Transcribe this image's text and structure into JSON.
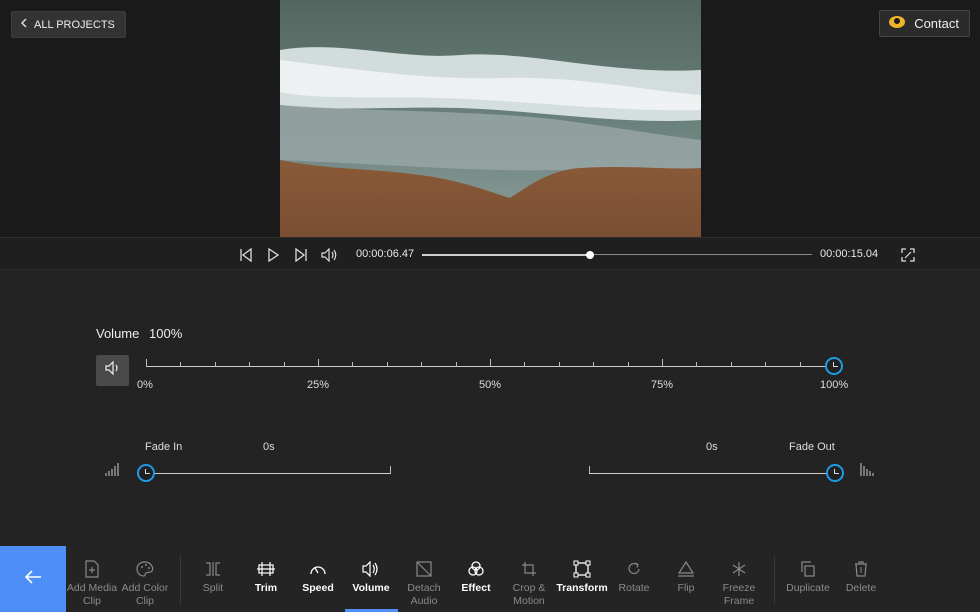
{
  "header": {
    "back_label": "ALL PROJECTS",
    "contact_label": "Contact"
  },
  "player": {
    "current_time": "00:00:06.47",
    "total_time": "00:00:15.04",
    "progress": 0.43
  },
  "volume_panel": {
    "title": "Volume",
    "value": "100%",
    "level": 1.0,
    "ticks": [
      "0%",
      "25%",
      "50%",
      "75%",
      "100%"
    ],
    "fade_in": {
      "label": "Fade In",
      "value": "0s"
    },
    "fade_out": {
      "label": "Fade Out",
      "value": "0s"
    }
  },
  "toolbar": {
    "items": [
      {
        "label": "Add Media\nClip",
        "icon": "add-media-icon",
        "active": false
      },
      {
        "label": "Add Color\nClip",
        "icon": "palette-icon",
        "active": false
      },
      {
        "label": "Split",
        "icon": "split-icon",
        "active": false
      },
      {
        "label": "Trim",
        "icon": "trim-icon",
        "active": true
      },
      {
        "label": "Speed",
        "icon": "speed-icon",
        "active": true
      },
      {
        "label": "Volume",
        "icon": "volume-icon",
        "active": true
      },
      {
        "label": "Detach\nAudio",
        "icon": "detach-audio-icon",
        "active": false
      },
      {
        "label": "Effect",
        "icon": "effect-icon",
        "active": true
      },
      {
        "label": "Crop &\nMotion",
        "icon": "crop-icon",
        "active": false
      },
      {
        "label": "Transform",
        "icon": "transform-icon",
        "active": true
      },
      {
        "label": "Rotate",
        "icon": "rotate-icon",
        "active": false
      },
      {
        "label": "Flip",
        "icon": "flip-icon",
        "active": false
      },
      {
        "label": "Freeze\nFrame",
        "icon": "snowflake-icon",
        "active": false
      },
      {
        "label": "Duplicate",
        "icon": "duplicate-icon",
        "active": false
      },
      {
        "label": "Delete",
        "icon": "trash-icon",
        "active": false
      }
    ]
  },
  "colors": {
    "accent": "#4d8ef7",
    "handle": "#1e9be6",
    "background": "#232323"
  }
}
